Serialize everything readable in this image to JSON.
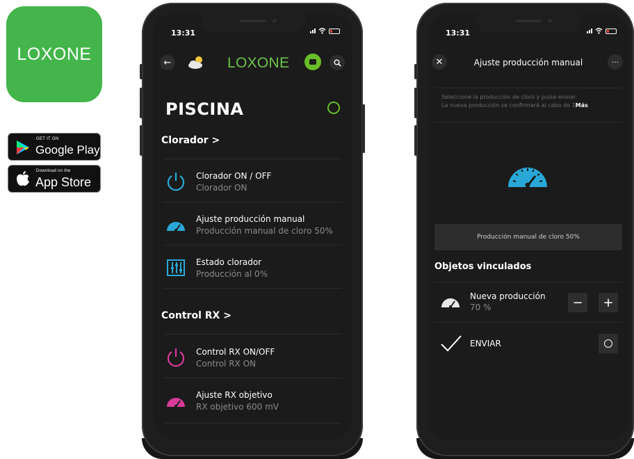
{
  "brand": {
    "app_icon_text": "LOXONE",
    "google_play": {
      "small": "GET IT ON",
      "big": "Google Play"
    },
    "app_store": {
      "small": "Download on the",
      "big": "App Store"
    },
    "colors": {
      "green": "#43b54a",
      "accent_green": "#69be28",
      "cyan": "#29a8d8",
      "magenta": "#d93a9a"
    }
  },
  "phone1": {
    "status_time": "13:31",
    "header_logo": "LOXONE",
    "room_title": "PISCINA",
    "categories": [
      {
        "title": "Clorador >",
        "items": [
          {
            "title": "Clorador ON / OFF",
            "subtitle": "Clorador ON",
            "icon": "power-icon"
          },
          {
            "title": "Ajuste producción manual",
            "subtitle": "Producción manual de cloro 50%",
            "icon": "gauge-icon"
          },
          {
            "title": "Estado clorador",
            "subtitle": "Producción al 0%",
            "icon": "status-panel-icon"
          }
        ]
      },
      {
        "title": "Control RX >",
        "items": [
          {
            "title": "Control RX ON/OFF",
            "subtitle": "Control RX ON",
            "icon": "power-icon"
          },
          {
            "title": "Ajuste RX objetivo",
            "subtitle": "RX objetivo 600 mV",
            "icon": "gauge-icon"
          }
        ]
      }
    ]
  },
  "phone2": {
    "status_time": "13:31",
    "title": "Ajuste producción manual",
    "description_line1": "Seleccione la producción de cloro y pulse enviar.",
    "description_line2": "La nueva producción se confirmará al cabo de 1",
    "more_link": "Más",
    "value_text": "Producción manual de cloro 50%",
    "linked_title": "Objetos vinculados",
    "linked_item": {
      "title": "Nueva producción",
      "value": "70 %",
      "minus": "−",
      "plus": "+"
    },
    "send": {
      "label": "ENVIAR"
    }
  }
}
